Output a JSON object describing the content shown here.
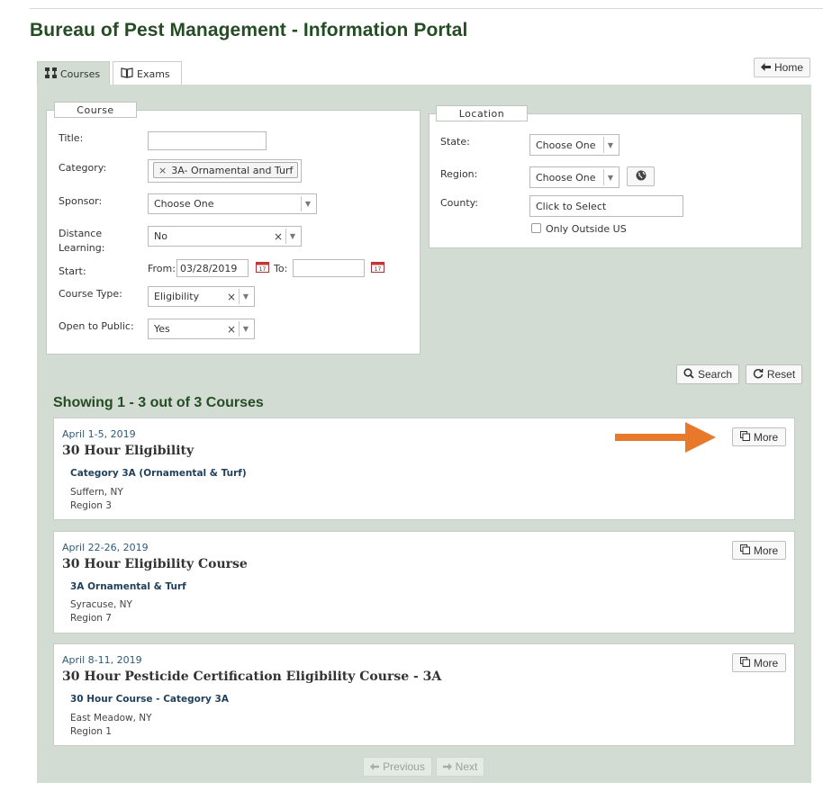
{
  "page_title": "Bureau of Pest Management - Information Portal",
  "tabs": [
    {
      "label": "Courses",
      "icon": "sitemap-icon",
      "active": true
    },
    {
      "label": "Exams",
      "icon": "book-icon",
      "active": false
    }
  ],
  "home_button": {
    "label": "Home",
    "icon": "arrow-left-icon"
  },
  "course_panel": {
    "legend": "Course",
    "title_label": "Title:",
    "title_value": "",
    "category_label": "Category:",
    "category_tag": "3A- Ornamental and Turf",
    "sponsor_label": "Sponsor:",
    "sponsor_value": "Choose One",
    "distance_label_1": "Distance",
    "distance_label_2": "Learning:",
    "distance_value": "No",
    "start_label": "Start:",
    "from_label": "From:",
    "from_value": "03/28/2019",
    "to_label": "To:",
    "to_value": "",
    "type_label": "Course Type:",
    "type_value": "Eligibility",
    "public_label": "Open to Public:",
    "public_value": "Yes"
  },
  "location_panel": {
    "legend": "Location",
    "state_label": "State:",
    "state_value": "Choose One",
    "region_label": "Region:",
    "region_value": "Choose One",
    "county_label": "County:",
    "county_value": "Click to Select",
    "outside_label": "Only Outside US"
  },
  "search_button": "Search",
  "reset_button": "Reset",
  "results_heading": "Showing 1 - 3 out of 3 Courses",
  "more_label": "More",
  "courses": [
    {
      "date": "April 1-5, 2019",
      "title": "30 Hour Eligibility",
      "category": "Category 3A (Ornamental & Turf)",
      "city": "Suffern, NY",
      "region": "Region 3"
    },
    {
      "date": "April 22-26, 2019",
      "title": "30 Hour Eligibility Course",
      "category": "3A Ornamental & Turf",
      "city": "Syracuse, NY",
      "region": "Region 7"
    },
    {
      "date": "April 8-11, 2019",
      "title": "30 Hour Pesticide Certification Eligibility Course - 3A",
      "category": "30 Hour Course - Category 3A",
      "city": "East Meadow, NY",
      "region": "Region 1"
    }
  ],
  "pager": {
    "previous": "Previous",
    "next": "Next"
  },
  "colors": {
    "brand_green": "#254d24",
    "panel_bg": "#d3dcd3",
    "annotation_arrow": "#e8792a"
  }
}
